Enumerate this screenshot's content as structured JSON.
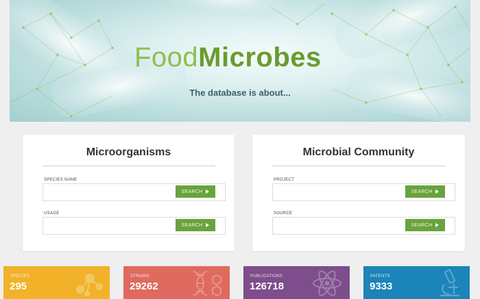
{
  "hero": {
    "brand_part1": "Food",
    "brand_part2": "Microbes",
    "tagline": "The database is about..."
  },
  "panels": [
    {
      "title": "Microorganisms",
      "fields": [
        {
          "label": "SPECIES NAME",
          "value": "",
          "button": "SEARCH"
        },
        {
          "label": "USAGE",
          "value": "",
          "button": "SEARCH"
        }
      ]
    },
    {
      "title": "Microbial Community",
      "fields": [
        {
          "label": "PROJECT",
          "value": "",
          "button": "SEARCH"
        },
        {
          "label": "SOURCE",
          "value": "",
          "button": "SEARCH"
        }
      ]
    }
  ],
  "stats": [
    {
      "label": "SPECIES",
      "value": "295",
      "color": "#f1b22a",
      "icon": "molecule-icon"
    },
    {
      "label": "STRAINS",
      "value": "29262",
      "color": "#df6a5f",
      "icon": "dna-icon"
    },
    {
      "label": "PUBLICATIONS",
      "value": "126718",
      "color": "#7d4d8c",
      "icon": "atom-icon"
    },
    {
      "label": "PATENTS",
      "value": "9333",
      "color": "#1b84b8",
      "icon": "microscope-icon"
    }
  ],
  "colors": {
    "accent_green": "#6aa33c",
    "page_background": "#efefef"
  }
}
